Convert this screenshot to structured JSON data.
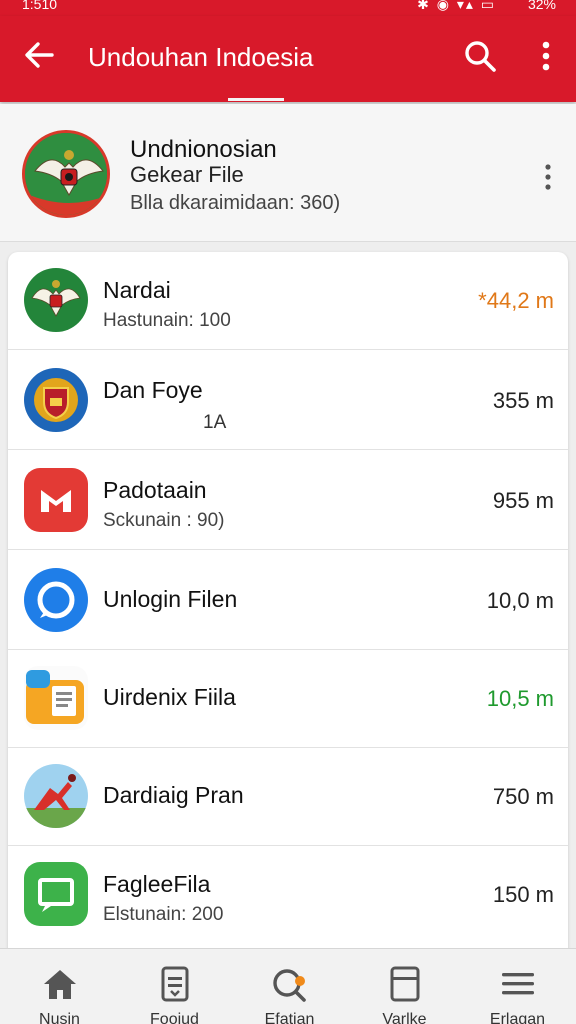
{
  "status_bar": {
    "time": "1:510",
    "battery": "32%"
  },
  "app_bar": {
    "title": "Undouhan Indoesia"
  },
  "header": {
    "title": "Undnionosian",
    "subtitle": "Gekear File",
    "meta": "Blla dkaraimidaan: 360)"
  },
  "rows": [
    {
      "name": "Nardai",
      "sub": "Hastunain: 100",
      "size": "*44,2 m",
      "size_color": "#e07818"
    },
    {
      "name": "Dan Foye",
      "sub": "1A",
      "size": "355 m",
      "size_color": "#222222"
    },
    {
      "name": "Padotaain",
      "sub": "Sckunain : 90)",
      "size": "955 m",
      "size_color": "#222222"
    },
    {
      "name": "Unlogin Filen",
      "sub": "",
      "size": "10,0 m",
      "size_color": "#222222"
    },
    {
      "name": "Uirdenix Fiila",
      "sub": "",
      "size": "10,5 m",
      "size_color": "#1f9a2e"
    },
    {
      "name": "Dardiaig Pran",
      "sub": "",
      "size": "750 m",
      "size_color": "#222222"
    },
    {
      "name": "FagleeFila",
      "sub": "Elstunain: 200",
      "size": "150 m",
      "size_color": "#222222"
    }
  ],
  "icons": [
    "garuda-emblem-icon",
    "shield-emblem-icon",
    "red-m-app-icon",
    "chat-bubble-icon",
    "folder-document-icon",
    "runner-landscape-icon",
    "green-screen-icon"
  ],
  "bottom_nav": [
    {
      "label": "Nusin",
      "icon": "home-icon"
    },
    {
      "label": "Fooiud",
      "icon": "document-icon"
    },
    {
      "label": "Efatian",
      "icon": "search-badge-icon"
    },
    {
      "label": "Varlke",
      "icon": "bookmark-box-icon"
    },
    {
      "label": "Erlagan",
      "icon": "menu-icon"
    }
  ],
  "colors": {
    "brand_red": "#d8192a",
    "accent_orange": "#e07818",
    "accent_green": "#1f9a2e"
  }
}
